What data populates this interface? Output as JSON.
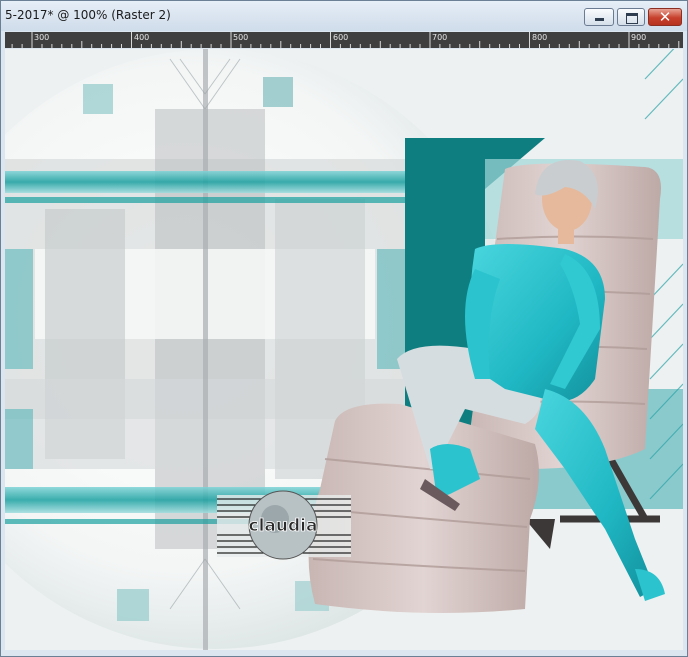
{
  "window": {
    "title": "5-2017* @ 100% (Raster 2)",
    "buttons": {
      "minimize": "minimize",
      "maximize": "maximize",
      "close": "✕"
    }
  },
  "ruler": {
    "labels": [
      "300",
      "400",
      "500",
      "600",
      "700",
      "800",
      "900"
    ]
  },
  "watermark": {
    "text": "claudia"
  },
  "colors": {
    "teal": "#1aa0a0",
    "teal_dark": "#0e7e80",
    "cyan": "#26c4cf",
    "chair": "#d3c2c0"
  }
}
